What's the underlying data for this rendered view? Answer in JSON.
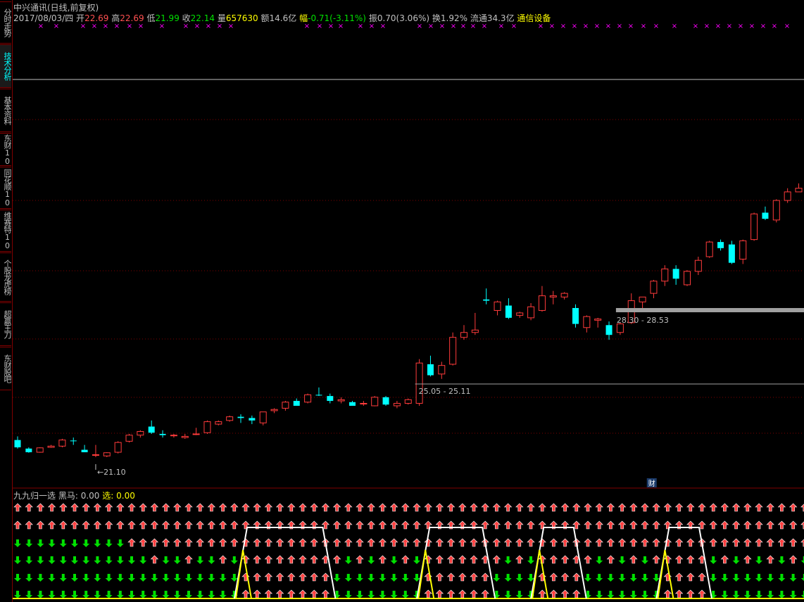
{
  "sidebar": {
    "tabs": [
      {
        "label": "分时走势",
        "active": false
      },
      {
        "label": "技术分析",
        "active": true
      },
      {
        "label": "基本资料",
        "active": false
      },
      {
        "label": "东财10",
        "active": false
      },
      {
        "label": "同花顺10",
        "active": false
      },
      {
        "label": "维赛特10",
        "active": false
      },
      {
        "label": "个股龙虎榜",
        "active": false
      },
      {
        "label": "超赢王刀",
        "active": false
      },
      {
        "label": "东财股吧",
        "active": false
      }
    ]
  },
  "header": {
    "title": "中兴通讯(日线,前复权)",
    "date": "2017/08/03/四",
    "open_label": "开",
    "open": "22.69",
    "high_label": "高",
    "high": "22.69",
    "low_label": "低",
    "low": "21.99",
    "close_label": "收",
    "close": "22.14",
    "vol_label": "量",
    "vol": "657630",
    "amount_label": "额",
    "amount": "14.6亿",
    "change_label": "幅",
    "change": "-0.71(-3.11%)",
    "amplitude_label": "振",
    "amplitude": "0.70(3.06%)",
    "turnover_label": "换",
    "turnover": "1.92%",
    "float_label": "流通",
    "float": "34.3亿",
    "sector": "通信设备"
  },
  "indicator": {
    "name": "九九归一选",
    "black_horse_label": "黑马:",
    "black_horse_value": "0.00",
    "select_label": "选:",
    "select_value": "0.00"
  },
  "colors": {
    "up": "#ff3b3b",
    "down": "#00ffff",
    "grid": "#800000",
    "arrow_up": "#ff4040",
    "arrow_down": "#00e000",
    "magenta": "#ff00ff",
    "gray_band": "#a0a0a0",
    "white": "#ffffff",
    "yellow": "#ffff00"
  },
  "chart_data": {
    "type": "candlestick",
    "title": "中兴通讯(日线,前复权)",
    "price_range": [
      20.2,
      35.6
    ],
    "annotations": [
      {
        "text": "21.10",
        "price": 21.1,
        "bar": 7
      },
      {
        "text": "25.05 - 25.11",
        "price": 25.11,
        "bar": 36
      },
      {
        "text": "28.30 - 28.53",
        "price": 28.53,
        "bar": 54
      },
      {
        "text": "财",
        "bar": 55
      }
    ],
    "candles": [
      {
        "o": 21.8,
        "h": 21.95,
        "l": 21.45,
        "c": 21.5
      },
      {
        "o": 21.45,
        "h": 21.5,
        "l": 21.28,
        "c": 21.3
      },
      {
        "o": 21.3,
        "h": 21.5,
        "l": 21.28,
        "c": 21.48
      },
      {
        "o": 21.5,
        "h": 21.6,
        "l": 21.48,
        "c": 21.55
      },
      {
        "o": 21.55,
        "h": 21.85,
        "l": 21.5,
        "c": 21.8
      },
      {
        "o": 21.78,
        "h": 21.9,
        "l": 21.6,
        "c": 21.75
      },
      {
        "o": 21.4,
        "h": 21.6,
        "l": 21.3,
        "c": 21.3
      },
      {
        "o": 21.2,
        "h": 21.6,
        "l": 21.1,
        "c": 21.2
      },
      {
        "o": 21.15,
        "h": 21.3,
        "l": 21.1,
        "c": 21.28
      },
      {
        "o": 21.3,
        "h": 21.75,
        "l": 21.25,
        "c": 21.7
      },
      {
        "o": 21.75,
        "h": 22.05,
        "l": 21.7,
        "c": 22.0
      },
      {
        "o": 22.0,
        "h": 22.2,
        "l": 21.9,
        "c": 22.15
      },
      {
        "o": 22.35,
        "h": 22.6,
        "l": 22.05,
        "c": 22.1
      },
      {
        "o": 22.05,
        "h": 22.2,
        "l": 21.9,
        "c": 22.0
      },
      {
        "o": 21.98,
        "h": 22.05,
        "l": 21.9,
        "c": 22.0
      },
      {
        "o": 21.9,
        "h": 22.05,
        "l": 21.85,
        "c": 21.95
      },
      {
        "o": 22.05,
        "h": 22.3,
        "l": 22.0,
        "c": 22.05
      },
      {
        "o": 22.1,
        "h": 22.6,
        "l": 22.05,
        "c": 22.55
      },
      {
        "o": 22.45,
        "h": 22.6,
        "l": 22.4,
        "c": 22.55
      },
      {
        "o": 22.6,
        "h": 22.8,
        "l": 22.55,
        "c": 22.75
      },
      {
        "o": 22.75,
        "h": 22.85,
        "l": 22.5,
        "c": 22.7
      },
      {
        "o": 22.7,
        "h": 22.8,
        "l": 22.45,
        "c": 22.6
      },
      {
        "o": 22.5,
        "h": 22.9,
        "l": 22.4,
        "c": 22.95
      },
      {
        "o": 23.0,
        "h": 23.1,
        "l": 22.9,
        "c": 23.05
      },
      {
        "o": 23.1,
        "h": 23.4,
        "l": 23.0,
        "c": 23.35
      },
      {
        "o": 23.4,
        "h": 23.5,
        "l": 23.3,
        "c": 23.2
      },
      {
        "o": 23.35,
        "h": 23.7,
        "l": 23.3,
        "c": 23.65
      },
      {
        "o": 23.65,
        "h": 23.95,
        "l": 23.6,
        "c": 23.62
      },
      {
        "o": 23.6,
        "h": 23.7,
        "l": 23.3,
        "c": 23.4
      },
      {
        "o": 23.4,
        "h": 23.55,
        "l": 23.3,
        "c": 23.45
      },
      {
        "o": 23.35,
        "h": 23.4,
        "l": 23.2,
        "c": 23.2
      },
      {
        "o": 23.3,
        "h": 23.4,
        "l": 23.2,
        "c": 23.3
      },
      {
        "o": 23.2,
        "h": 23.6,
        "l": 23.18,
        "c": 23.55
      },
      {
        "o": 23.55,
        "h": 23.6,
        "l": 23.2,
        "c": 23.25
      },
      {
        "o": 23.2,
        "h": 23.4,
        "l": 23.1,
        "c": 23.3
      },
      {
        "o": 23.3,
        "h": 23.5,
        "l": 23.25,
        "c": 23.45
      },
      {
        "o": 23.3,
        "h": 25.11,
        "l": 23.2,
        "c": 24.95
      },
      {
        "o": 24.9,
        "h": 25.25,
        "l": 24.4,
        "c": 24.45
      },
      {
        "o": 24.5,
        "h": 25.0,
        "l": 24.3,
        "c": 24.85
      },
      {
        "o": 24.9,
        "h": 26.2,
        "l": 24.85,
        "c": 26.0
      },
      {
        "o": 26.0,
        "h": 26.5,
        "l": 25.9,
        "c": 26.2
      },
      {
        "o": 26.2,
        "h": 27.0,
        "l": 26.1,
        "c": 26.3
      },
      {
        "o": 27.55,
        "h": 28.0,
        "l": 27.35,
        "c": 27.5
      },
      {
        "o": 27.1,
        "h": 27.5,
        "l": 26.9,
        "c": 27.45
      },
      {
        "o": 27.3,
        "h": 27.6,
        "l": 26.75,
        "c": 26.8
      },
      {
        "o": 26.9,
        "h": 27.05,
        "l": 26.8,
        "c": 27.0
      },
      {
        "o": 26.8,
        "h": 27.4,
        "l": 26.7,
        "c": 27.25
      },
      {
        "o": 27.1,
        "h": 28.1,
        "l": 27.05,
        "c": 27.7
      },
      {
        "o": 27.65,
        "h": 27.9,
        "l": 27.35,
        "c": 27.7
      },
      {
        "o": 27.65,
        "h": 27.85,
        "l": 27.55,
        "c": 27.8
      },
      {
        "o": 27.2,
        "h": 27.35,
        "l": 26.4,
        "c": 26.55
      },
      {
        "o": 26.4,
        "h": 26.9,
        "l": 26.2,
        "c": 26.85
      },
      {
        "o": 26.7,
        "h": 26.8,
        "l": 26.4,
        "c": 26.75
      },
      {
        "o": 26.5,
        "h": 26.65,
        "l": 25.9,
        "c": 26.1
      },
      {
        "o": 26.2,
        "h": 26.6,
        "l": 26.1,
        "c": 26.55
      },
      {
        "o": 26.6,
        "h": 27.8,
        "l": 26.55,
        "c": 27.5
      },
      {
        "o": 27.45,
        "h": 27.6,
        "l": 27.2,
        "c": 27.65
      },
      {
        "o": 27.8,
        "h": 28.35,
        "l": 27.6,
        "c": 28.3
      },
      {
        "o": 28.3,
        "h": 28.95,
        "l": 28.1,
        "c": 28.8
      },
      {
        "o": 28.8,
        "h": 28.95,
        "l": 28.15,
        "c": 28.4
      },
      {
        "o": 28.15,
        "h": 28.75,
        "l": 28.1,
        "c": 28.7
      },
      {
        "o": 28.7,
        "h": 29.3,
        "l": 28.55,
        "c": 29.15
      },
      {
        "o": 29.3,
        "h": 29.95,
        "l": 29.25,
        "c": 29.9
      },
      {
        "o": 29.9,
        "h": 30.0,
        "l": 29.55,
        "c": 29.65
      },
      {
        "o": 29.8,
        "h": 29.95,
        "l": 29.0,
        "c": 29.05
      },
      {
        "o": 29.2,
        "h": 30.0,
        "l": 29.0,
        "c": 29.95
      },
      {
        "o": 30.0,
        "h": 31.1,
        "l": 29.95,
        "c": 31.05
      },
      {
        "o": 31.1,
        "h": 31.35,
        "l": 30.8,
        "c": 30.85
      },
      {
        "o": 30.8,
        "h": 31.65,
        "l": 30.7,
        "c": 31.6
      },
      {
        "o": 31.6,
        "h": 32.1,
        "l": 31.5,
        "c": 31.95
      },
      {
        "o": 31.95,
        "h": 32.3,
        "l": 31.95,
        "c": 32.1
      },
      {
        "o": 31.95,
        "h": 32.4,
        "l": 31.85,
        "c": 32.0
      },
      {
        "o": 31.95,
        "h": 32.05,
        "l": 31.3,
        "c": 31.45
      },
      {
        "o": 32.1,
        "h": 32.5,
        "l": 31.8,
        "c": 32.55
      }
    ]
  }
}
